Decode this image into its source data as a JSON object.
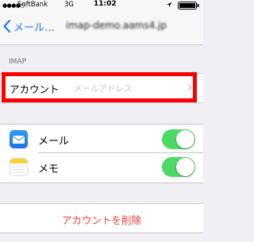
{
  "status_bar": {
    "signal": "●●●●○",
    "carrier": "SoftBank",
    "network": "3G",
    "time": "11:02"
  },
  "nav": {
    "back_label": "メール…",
    "title": "imap-demo.aams4.jp"
  },
  "section": {
    "header": "IMAP"
  },
  "account_row": {
    "label": "アカウント",
    "placeholder": "メールアドレス"
  },
  "toggles": [
    {
      "label": "メール",
      "on": true,
      "icon": "mail-icon"
    },
    {
      "label": "メモ",
      "on": true,
      "icon": "notes-icon"
    }
  ],
  "delete_button": {
    "label": "アカウントを削除"
  },
  "colors": {
    "accent": "#1a7cf5",
    "toggle_on": "#4cd964",
    "destructive": "#ff3b30",
    "highlight": "#ff0000",
    "background": "#efeff4"
  }
}
